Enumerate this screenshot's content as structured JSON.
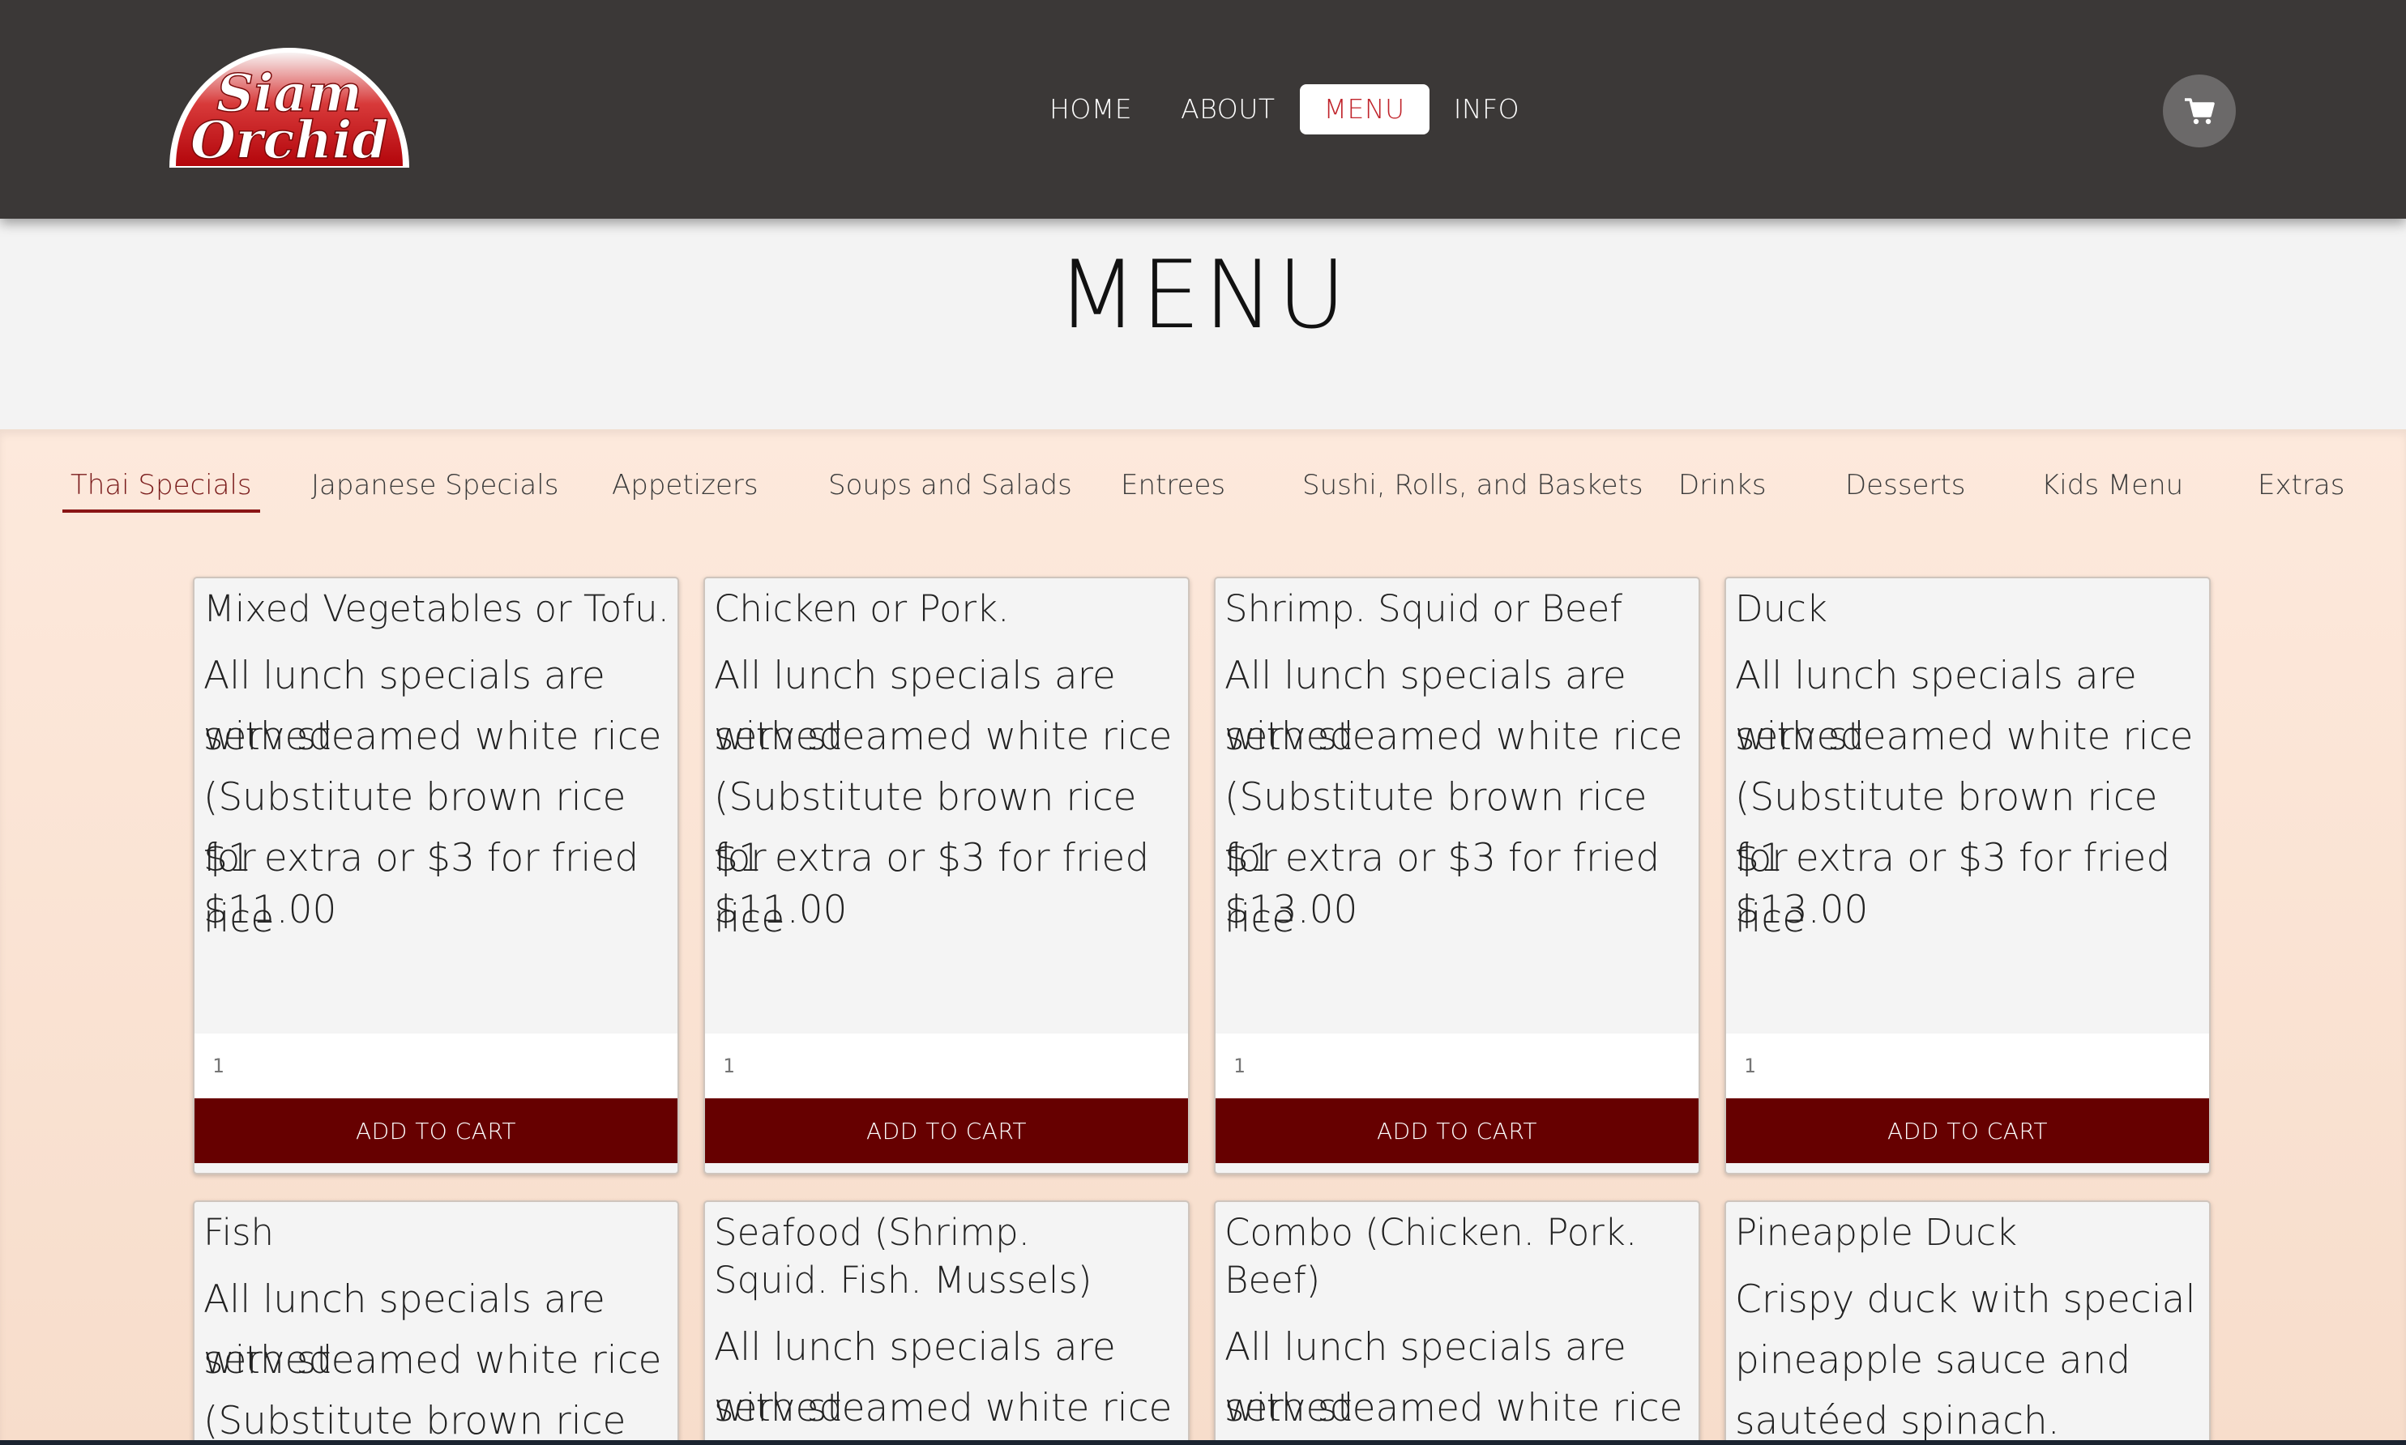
{
  "brand": {
    "logo_line1": "Siam",
    "logo_line2": "Orchid",
    "logo_color": "#c40f16"
  },
  "nav": {
    "items": [
      {
        "label": "HOME"
      },
      {
        "label": "ABOUT"
      },
      {
        "label": "MENU",
        "active": true
      },
      {
        "label": "INFO"
      }
    ],
    "cart_icon": "shopping-cart-icon"
  },
  "page": {
    "title": "MENU"
  },
  "tabs": [
    {
      "label": "Thai Specials",
      "active": true
    },
    {
      "label": "Japanese Specials"
    },
    {
      "label": "Appetizers"
    },
    {
      "label": "Soups and Salads"
    },
    {
      "label": "Entrees"
    },
    {
      "label": "Sushi, Rolls, and Baskets"
    },
    {
      "label": "Drinks"
    },
    {
      "label": "Desserts"
    },
    {
      "label": "Kids Menu"
    },
    {
      "label": "Extras"
    }
  ],
  "items": [
    {
      "name": "Mixed Vegetables or Tofu.",
      "desc_lines": [
        "All lunch specials are served",
        "with steamed white rice",
        "(Substitute brown rice for",
        "$1 extra or $3 for fried rice"
      ],
      "price": "$11.00",
      "qty_placeholder": "1",
      "button": "ADD TO CART"
    },
    {
      "name": "Chicken or Pork.",
      "desc_lines": [
        "All lunch specials are served",
        "with steamed white rice",
        "(Substitute brown rice for",
        "$1 extra or $3 for fried rice"
      ],
      "price": "$11.00",
      "qty_placeholder": "1",
      "button": "ADD TO CART"
    },
    {
      "name": "Shrimp. Squid or Beef",
      "desc_lines": [
        "All lunch specials are served",
        "with steamed white rice",
        "(Substitute brown rice for",
        "$1 extra or $3 for fried rice"
      ],
      "price": "$13.00",
      "qty_placeholder": "1",
      "button": "ADD TO CART"
    },
    {
      "name": "Duck",
      "desc_lines": [
        "All lunch specials are served",
        "with steamed white rice",
        "(Substitute brown rice for",
        "$1 extra or $3 for fried rice"
      ],
      "price": "$13.00",
      "qty_placeholder": "1",
      "button": "ADD TO CART"
    },
    {
      "name": "Fish",
      "desc_lines": [
        "All lunch specials are served",
        "with steamed white rice",
        "(Substitute brown rice for"
      ]
    },
    {
      "name": "Seafood (Shrimp. Squid. Fish. Mussels)",
      "desc_lines": [
        "All lunch specials are served",
        "with steamed white rice"
      ]
    },
    {
      "name": "Combo (Chicken. Pork. Beef)",
      "desc_lines": [
        "All lunch specials are served",
        "with steamed white rice"
      ]
    },
    {
      "name": "Pineapple Duck",
      "desc_lines": [
        "Crispy duck with special",
        "pineapple sauce and",
        "sautéed spinach."
      ]
    }
  ],
  "colors": {
    "nav_bg": "#3b3837",
    "active_nav_text": "#c0242b",
    "button_bg": "#660000",
    "menu_bg": "#fde9dc",
    "active_tab_underline": "#8a1515"
  }
}
